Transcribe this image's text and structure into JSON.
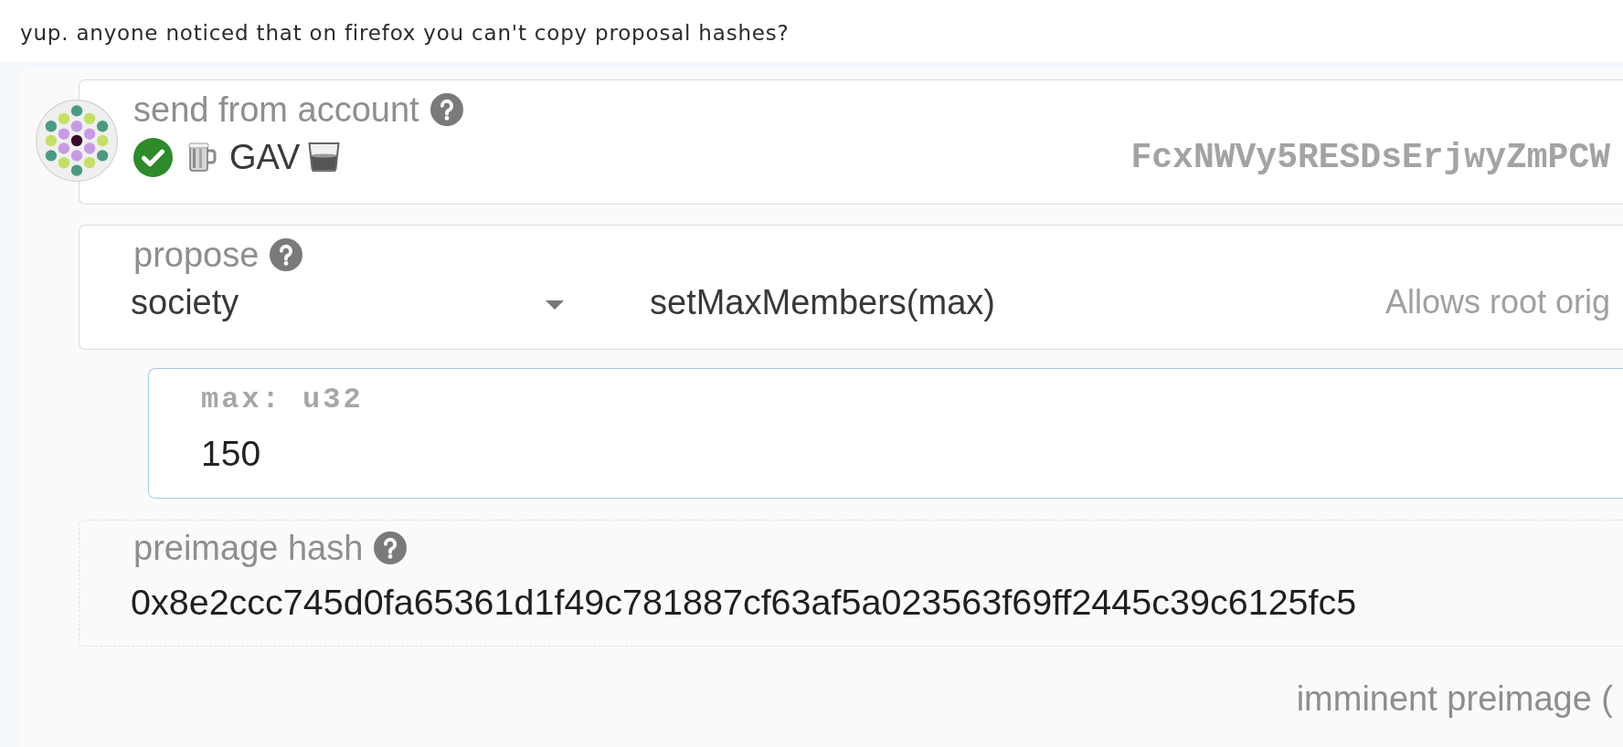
{
  "message": {
    "text": "yup. anyone noticed that on firefox you can't copy proposal hashes?"
  },
  "account": {
    "label": "send from account",
    "verified": true,
    "name": "GAV",
    "address": "FcxNWVy5RESDsErjwyZmPCW"
  },
  "propose": {
    "label": "propose",
    "section": "society",
    "method": "setMaxMembers(max)",
    "description": "Allows root orig"
  },
  "param": {
    "label": "max: u32",
    "value": "150",
    "focused": true
  },
  "preimage": {
    "label": "preimage hash",
    "hash": "0x8e2ccc745d0fa65361d1f49c781887cf63af5a023563f69ff2445c39c6125fc5"
  },
  "footer": {
    "text": "imminent preimage ("
  }
}
